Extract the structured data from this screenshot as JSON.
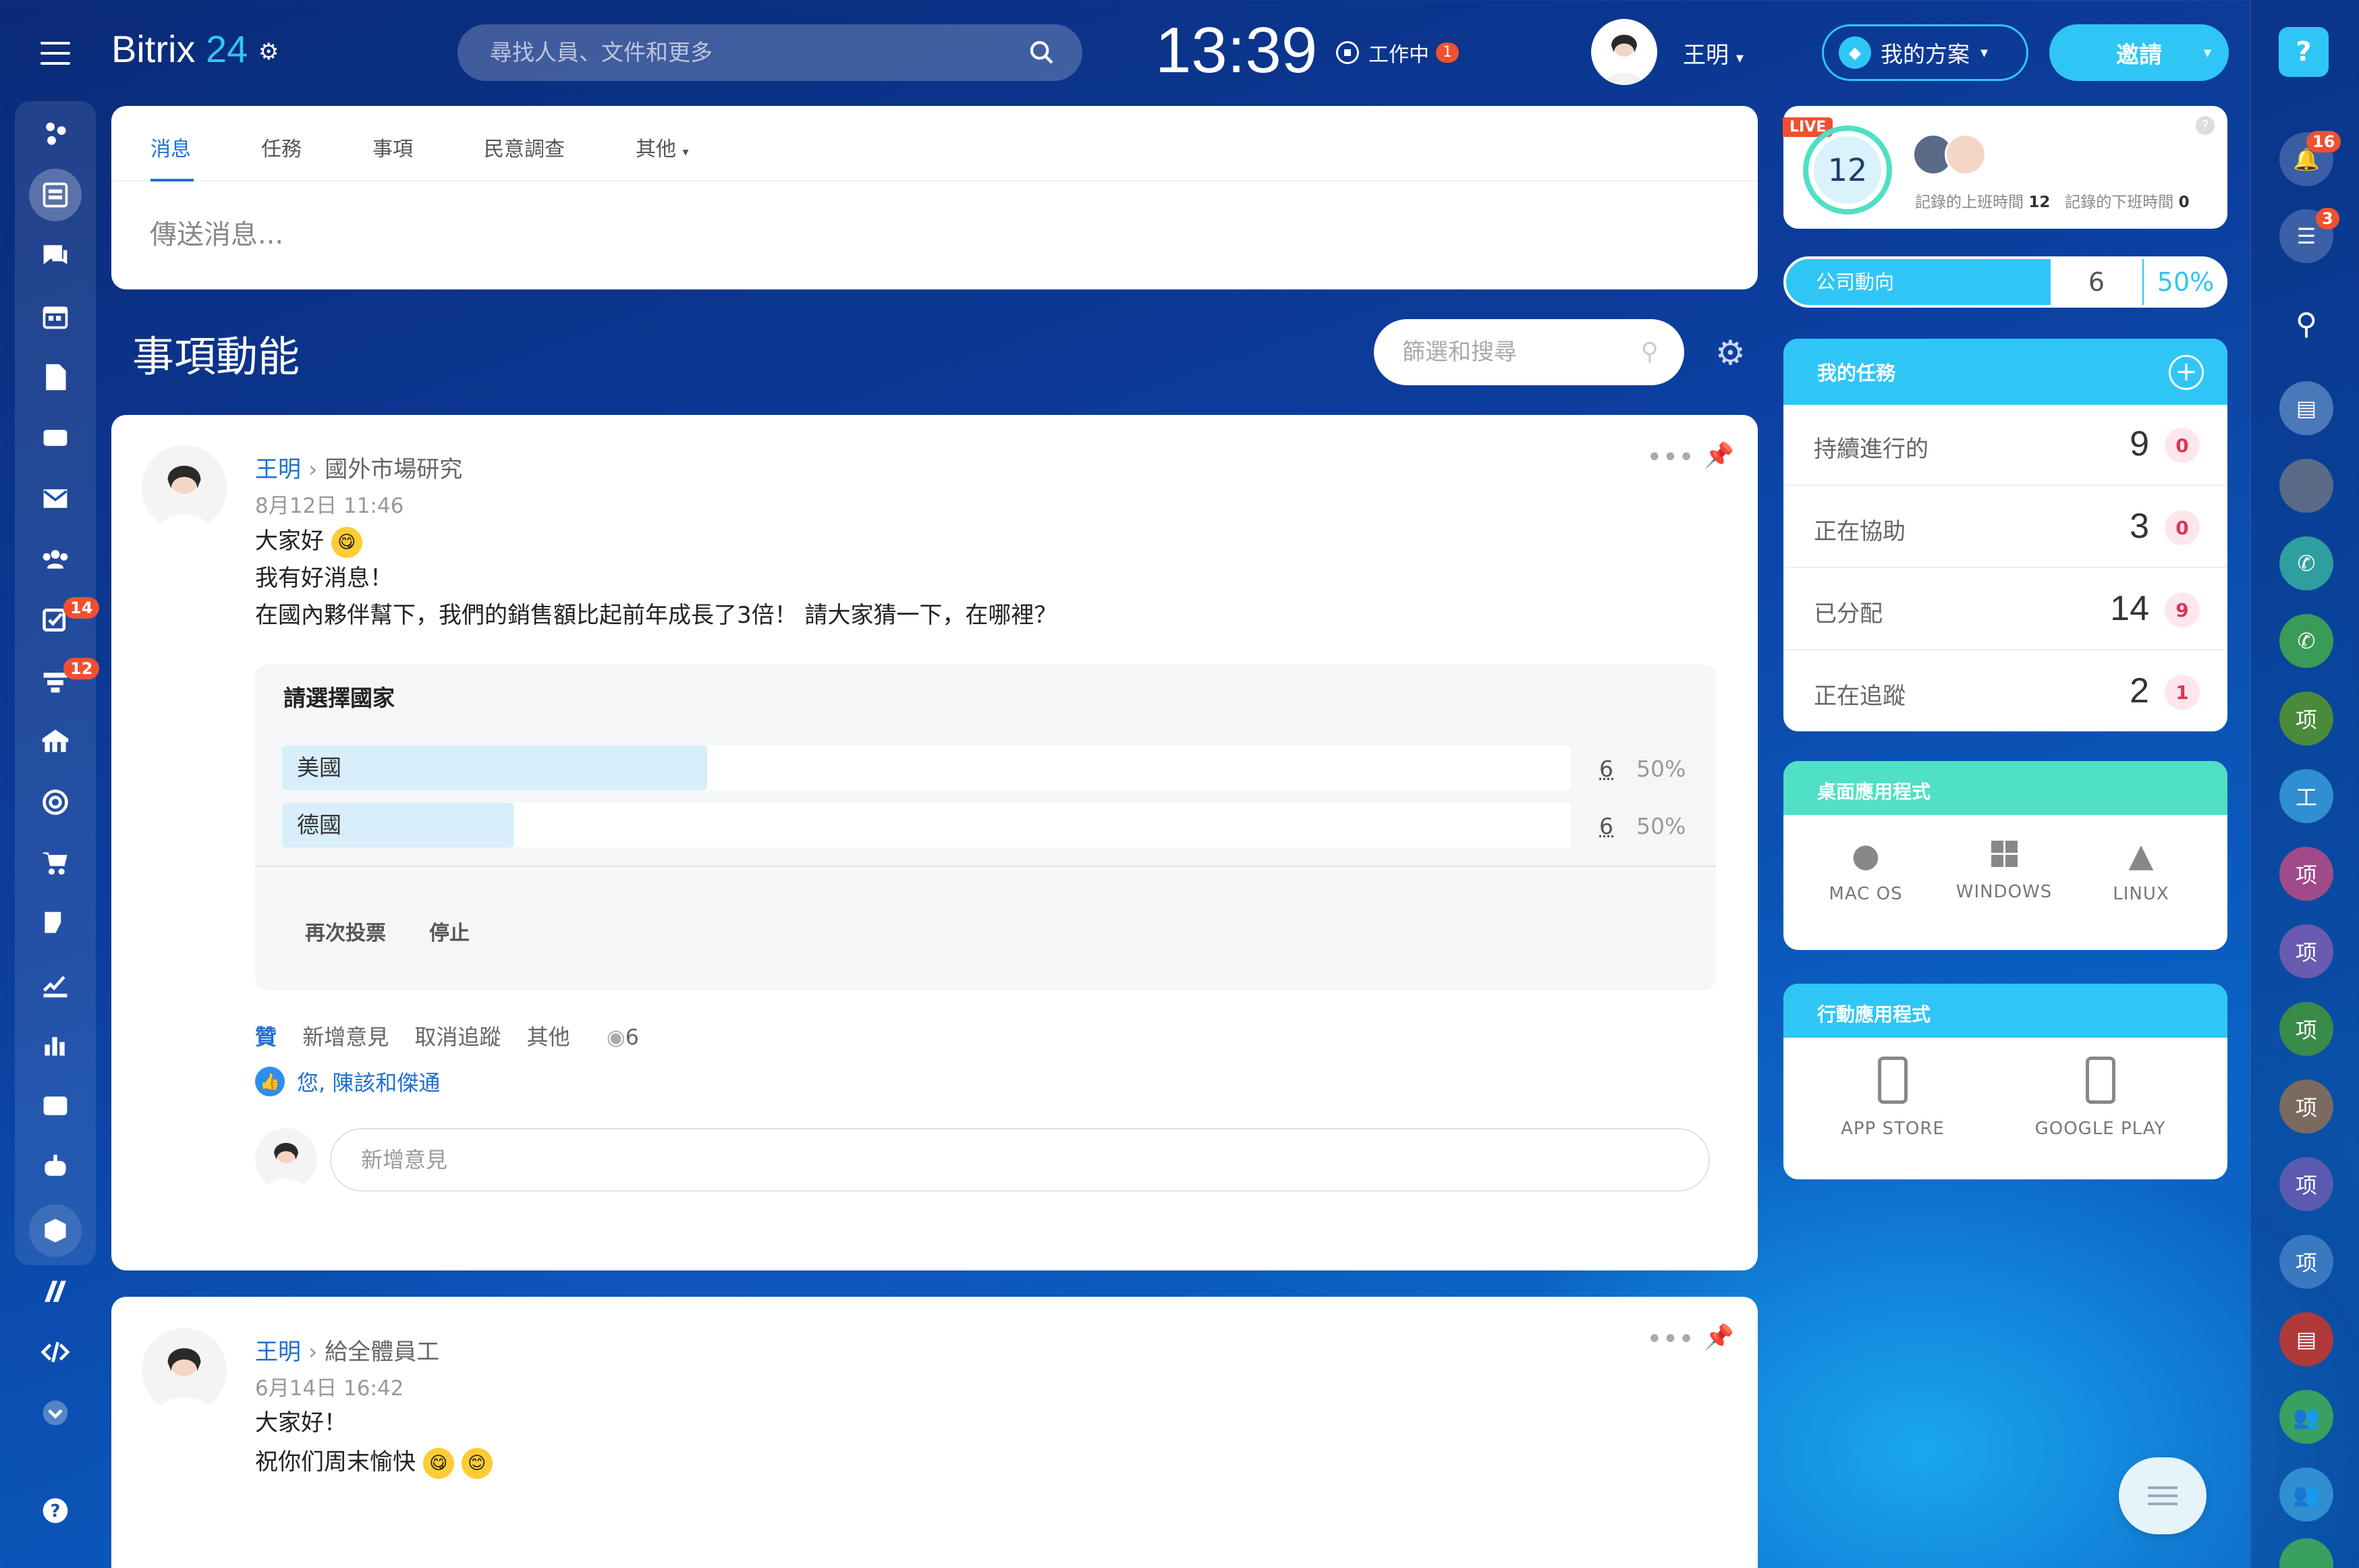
{
  "header": {
    "logo": "Bitrix",
    "logo_num": "24",
    "search_placeholder": "尋找人員、文件和更多",
    "clock": "13:39",
    "work_status": "工作中",
    "work_badge": "1",
    "user_name": "王明",
    "plan_button": "我的方案",
    "invite_button": "邀請"
  },
  "sidebar": {
    "badges": {
      "tasks": "14",
      "crm": "12"
    }
  },
  "composer": {
    "tabs": [
      "消息",
      "任務",
      "事項",
      "民意調查",
      "其他"
    ],
    "placeholder": "傳送消息..."
  },
  "feed": {
    "title": "事項動能",
    "filter_placeholder": "篩選和搜尋"
  },
  "post1": {
    "author": "王明",
    "target": "國外市場研究",
    "date": "8月12日 11:46",
    "line1": "大家好",
    "line2": "我有好消息！",
    "line3": "在國內夥伴幫下，我們的銷售額比起前年成長了3倍！ 請大家猜一下，在哪裡？",
    "poll": {
      "question": "請選擇國家",
      "options": [
        {
          "label": "美國",
          "votes": "6",
          "percent": "50%",
          "fill": 0.33
        },
        {
          "label": "德國",
          "votes": "6",
          "percent": "50%",
          "fill": 0.18
        }
      ],
      "revote": "再次投票",
      "stop": "停止"
    },
    "actions": {
      "like": "贊",
      "comment": "新增意見",
      "unfollow": "取消追蹤",
      "more": "其他",
      "views": "6"
    },
    "likes_text": "您, 陳該和傑通",
    "comment_placeholder": "新增意見"
  },
  "post2": {
    "author": "王明",
    "target": "給全體員工",
    "date": "6月14日 16:42",
    "line1": "大家好！",
    "line2": "祝你们周末愉快"
  },
  "timeman": {
    "live": "LIVE",
    "count": "12",
    "in_label": "記錄的上班時間",
    "in_value": "12",
    "out_label": "記錄的下班時間",
    "out_value": "0"
  },
  "company_pulse": {
    "label": "公司動向",
    "value": "6",
    "percent": "50%"
  },
  "my_tasks": {
    "title": "我的任務",
    "rows": [
      {
        "label": "持續進行的",
        "count": "9",
        "badge": "0"
      },
      {
        "label": "正在協助",
        "count": "3",
        "badge": "0"
      },
      {
        "label": "已分配",
        "count": "14",
        "badge": "9"
      },
      {
        "label": "正在追蹤",
        "count": "2",
        "badge": "1"
      }
    ]
  },
  "desktop_apps": {
    "title": "桌面應用程式",
    "items": [
      "MAC OS",
      "WINDOWS",
      "LINUX"
    ]
  },
  "mobile_apps": {
    "title": "行動應用程式",
    "items": [
      "APP STORE",
      "GOOGLE PLAY"
    ]
  },
  "rightbar": {
    "notif_badge": "16",
    "chat_badge": "3",
    "chars": [
      "项",
      "工",
      "项",
      "项",
      "项",
      "项",
      "项",
      "项"
    ]
  },
  "colors": {
    "accent": "#1f6fd1",
    "cyan": "#2fc6f6",
    "mint": "#4fe0c6",
    "badge_red": "#f0502f"
  }
}
